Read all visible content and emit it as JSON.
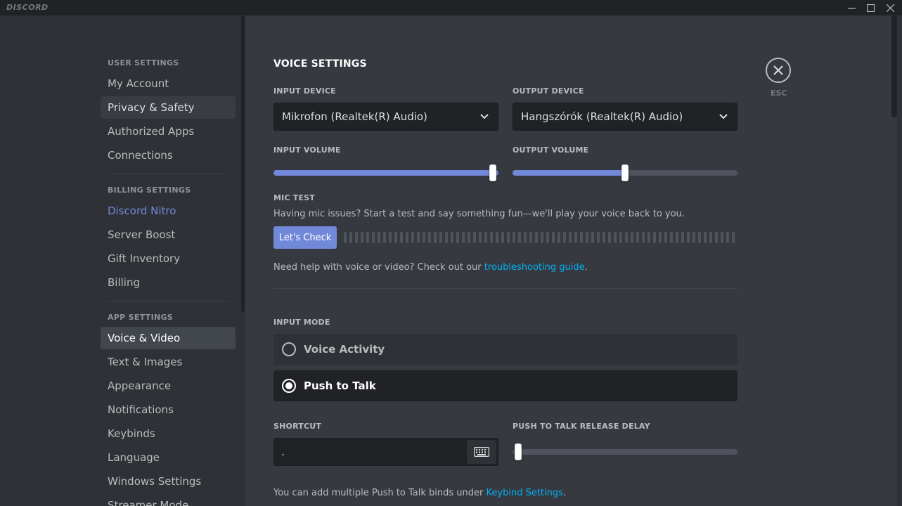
{
  "window": {
    "brand": "DISCORD",
    "minimize_icon": "minimize-icon",
    "maximize_icon": "maximize-icon",
    "close_icon": "close-icon"
  },
  "sidebar": {
    "user_settings_header": "USER SETTINGS",
    "user_items": [
      "My Account",
      "Privacy & Safety",
      "Authorized Apps",
      "Connections"
    ],
    "billing_header": "BILLING SETTINGS",
    "billing_items": [
      "Discord Nitro",
      "Server Boost",
      "Gift Inventory",
      "Billing"
    ],
    "app_header": "APP SETTINGS",
    "app_items": [
      "Voice & Video",
      "Text & Images",
      "Appearance",
      "Notifications",
      "Keybinds",
      "Language",
      "Windows Settings",
      "Streamer Mode"
    ]
  },
  "voice": {
    "title": "VOICE SETTINGS",
    "input_device_label": "INPUT DEVICE",
    "input_device_value": "Mikrofon (Realtek(R) Audio)",
    "output_device_label": "OUTPUT DEVICE",
    "output_device_value": "Hangszórók (Realtek(R) Audio)",
    "input_volume_label": "INPUT VOLUME",
    "input_volume_fraction": 1.0,
    "output_volume_label": "OUTPUT VOLUME",
    "output_volume_fraction": 0.5,
    "mic_test_label": "MIC TEST",
    "mic_test_desc": "Having mic issues? Start a test and say something fun—we'll play your voice back to you.",
    "lets_check": "Let's Check",
    "help_text": "Need help with voice or video? Check out our ",
    "help_link": "troubleshooting guide",
    "help_end": "."
  },
  "input_mode": {
    "label": "INPUT MODE",
    "options": [
      "Voice Activity",
      "Push to Talk"
    ],
    "selected": "Push to Talk"
  },
  "shortcut": {
    "label": "SHORTCUT",
    "value": ".",
    "keyboard_icon": "keyboard-icon",
    "release_delay_label": "PUSH TO TALK RELEASE DELAY",
    "release_delay_fraction": 0.0,
    "binds_text": "You can add multiple Push to Talk binds under ",
    "binds_link": "Keybind Settings",
    "binds_end": "."
  },
  "esc": {
    "label": "ESC",
    "icon": "close-icon"
  },
  "colors": {
    "accent": "#7289da",
    "link": "#00b0f4",
    "bg_main": "#36393f",
    "bg_sidebar": "#2f3136",
    "bg_input": "#202225"
  }
}
